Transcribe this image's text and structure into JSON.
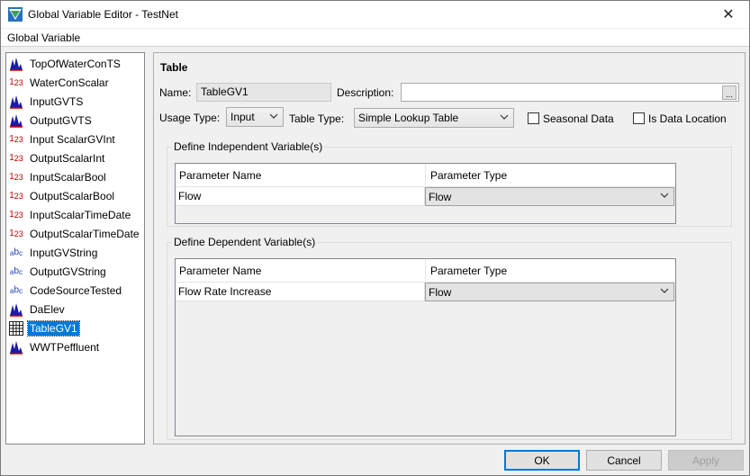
{
  "window": {
    "title": "Global Variable Editor - TestNet",
    "close_label": "✕"
  },
  "menu": {
    "global_variable": "Global Variable"
  },
  "variables": [
    {
      "icon": "timeseries-icon",
      "label": "TopOfWaterConTS"
    },
    {
      "icon": "scalar-icon",
      "label": "WaterConScalar"
    },
    {
      "icon": "timeseries-icon",
      "label": "InputGVTS"
    },
    {
      "icon": "timeseries-icon",
      "label": "OutputGVTS"
    },
    {
      "icon": "scalar-icon",
      "label": "Input ScalarGVInt"
    },
    {
      "icon": "scalar-icon",
      "label": "OutputScalarInt"
    },
    {
      "icon": "scalar-icon",
      "label": "InputScalarBool"
    },
    {
      "icon": "scalar-icon",
      "label": "OutputScalarBool"
    },
    {
      "icon": "scalar-icon",
      "label": "InputScalarTimeDate"
    },
    {
      "icon": "scalar-icon",
      "label": "OutputScalarTimeDate"
    },
    {
      "icon": "string-icon",
      "label": "InputGVString"
    },
    {
      "icon": "string-icon",
      "label": "OutputGVString"
    },
    {
      "icon": "string-icon",
      "label": "CodeSourceTested"
    },
    {
      "icon": "timeseries-icon",
      "label": "DaElev"
    },
    {
      "icon": "table-icon",
      "label": "TableGV1",
      "selected": true
    },
    {
      "icon": "timeseries-icon",
      "label": "WWTPeffluent"
    }
  ],
  "icon_text": {
    "scalar": "1",
    "scalar_sub": "2",
    "scalar_sub2": "3",
    "string_a": "a",
    "string_b": "b",
    "string_c": "c"
  },
  "detail": {
    "section_title": "Table",
    "name_label": "Name:",
    "name_value": "TableGV1",
    "description_label": "Description:",
    "description_value": "",
    "ellipsis": "...",
    "usage_type_label": "Usage Type:",
    "usage_type_value": "Input",
    "table_type_label": "Table Type:",
    "table_type_value": "Simple Lookup Table",
    "seasonal_data_label": "Seasonal Data",
    "seasonal_data_checked": false,
    "is_data_location_label": "Is Data Location",
    "is_data_location_checked": false
  },
  "independent": {
    "legend": "Define Independent Variable(s)",
    "col_name": "Parameter Name",
    "col_type": "Parameter Type",
    "rows": [
      {
        "name": "Flow",
        "type": "Flow"
      }
    ]
  },
  "dependent": {
    "legend": "Define Dependent Variable(s)",
    "col_name": "Parameter Name",
    "col_type": "Parameter Type",
    "rows": [
      {
        "name": "Flow Rate Increase",
        "type": "Flow"
      }
    ]
  },
  "buttons": {
    "ok": "OK",
    "cancel": "Cancel",
    "apply": "Apply"
  },
  "colors": {
    "selection": "#0078d7",
    "scalar_icon": "#c00000",
    "string_icon": "#1f3fbf",
    "ts_icon": "#1a1aa6"
  }
}
